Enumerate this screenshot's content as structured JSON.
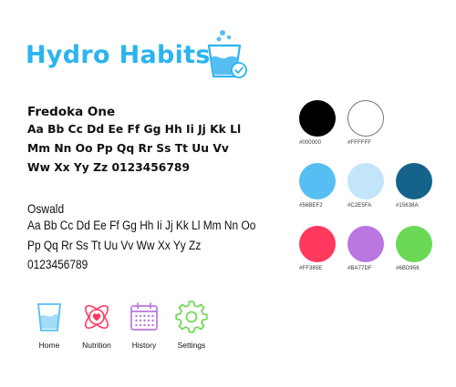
{
  "brand": {
    "title": "Hydro Habits",
    "logo_icon": "water-glass-with-bubbles-and-check-icon",
    "colors": {
      "title": "#2BB4EF",
      "logo_stroke": "#2BB4EF",
      "logo_fill": "#56BEF2"
    }
  },
  "typography": {
    "fredoka": {
      "name": "Fredoka One",
      "lines": [
        "Aa Bb Cc Dd Ee Ff Gg Hh Ii Jj Kk Ll",
        "Mm Nn Oo Pp Qq Rr Ss Tt Uu Vv",
        "Ww Xx Yy Zz 0123456789"
      ]
    },
    "oswald": {
      "name": "Oswald",
      "lines": [
        "Aa Bb Cc Dd Ee Ff Gg Hh Ii Jj Kk Ll Mm Nn Oo",
        "Pp Qq Rr Ss Tt Uu Vv Ww Xx Yy Zz",
        "0123456789"
      ]
    }
  },
  "nav": {
    "items": [
      {
        "label": "Home",
        "icon": "water-glass-icon",
        "color": "#56BEF2"
      },
      {
        "label": "Nutrition",
        "icon": "heart-atom-icon",
        "color": "#FF385E"
      },
      {
        "label": "History",
        "icon": "calendar-icon",
        "color": "#BA77DF"
      },
      {
        "label": "Settings",
        "icon": "gear-icon",
        "color": "#6BD956"
      }
    ]
  },
  "palette": {
    "swatches": [
      {
        "hex": "#000000",
        "label": "#000000"
      },
      {
        "hex": "#FFFFFF",
        "label": "#FFFFFF"
      },
      {
        "hex": "#56BEF2",
        "label": "#56BEF2"
      },
      {
        "hex": "#C2E5FA",
        "label": "#C2E5FA"
      },
      {
        "hex": "#15638A",
        "label": "#15638A"
      },
      {
        "hex": "#FF385E",
        "label": "#FF385E"
      },
      {
        "hex": "#BA77DF",
        "label": "#BA77DF"
      },
      {
        "hex": "#6BD956",
        "label": "#6BD956"
      }
    ]
  }
}
